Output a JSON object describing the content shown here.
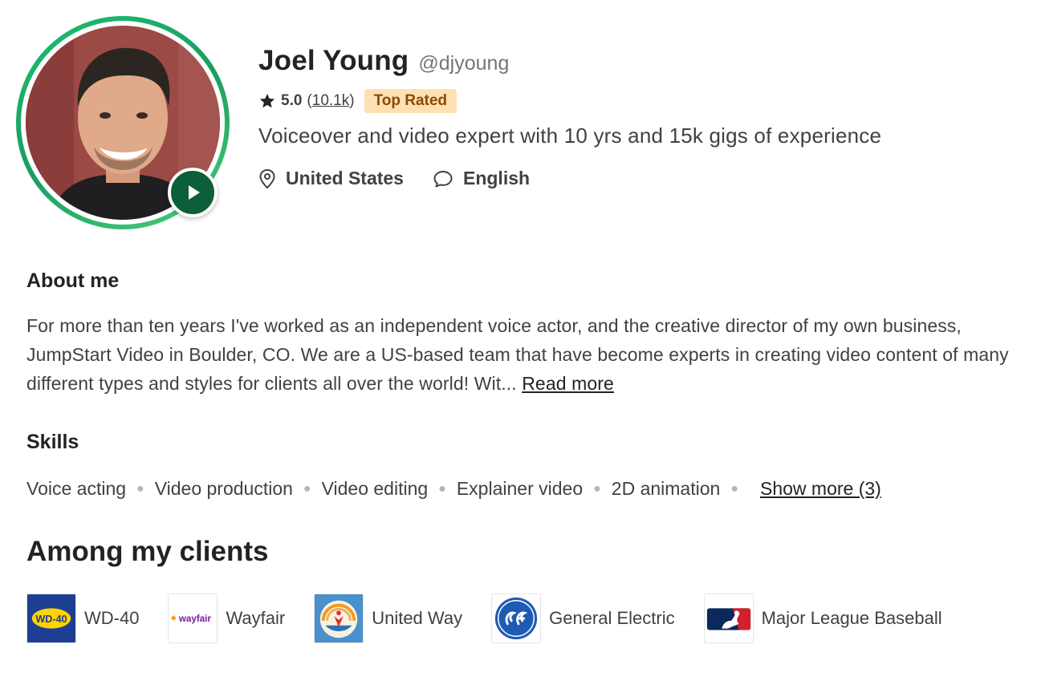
{
  "profile": {
    "name": "Joel Young",
    "handle": "@djyoung",
    "rating": "5.0",
    "review_count_open": "(",
    "review_count": "10.1k",
    "review_count_close": ")",
    "badge": "Top Rated",
    "tagline": "Voiceover and video expert with 10 yrs and 15k gigs of experience",
    "location": "United States",
    "language": "English"
  },
  "about": {
    "title": "About me",
    "text": "For more than ten years I've worked as an independent voice actor, and the creative director of my own business, JumpStart Video in Boulder, CO. We are a US-based team that have become experts in creating video content of many different types and styles for clients all over the world! Wit... ",
    "read_more": "Read more"
  },
  "skills": {
    "title": "Skills",
    "items": [
      "Voice acting",
      "Video production",
      "Video editing",
      "Explainer video",
      "2D animation"
    ],
    "show_more": "Show more (3)"
  },
  "clients": {
    "title": "Among my clients",
    "items": [
      {
        "name": "WD-40",
        "logo_text": "WD-40"
      },
      {
        "name": "Wayfair",
        "logo_text": "wayfair"
      },
      {
        "name": "United Way",
        "logo_text": ""
      },
      {
        "name": "General Electric",
        "logo_text": ""
      },
      {
        "name": "Major League Baseball",
        "logo_text": ""
      }
    ]
  },
  "colors": {
    "accent_green": "#1dbf73",
    "play_button": "#0b5f3a",
    "badge_bg": "#ffe0b3",
    "badge_text": "#8a4a06"
  }
}
